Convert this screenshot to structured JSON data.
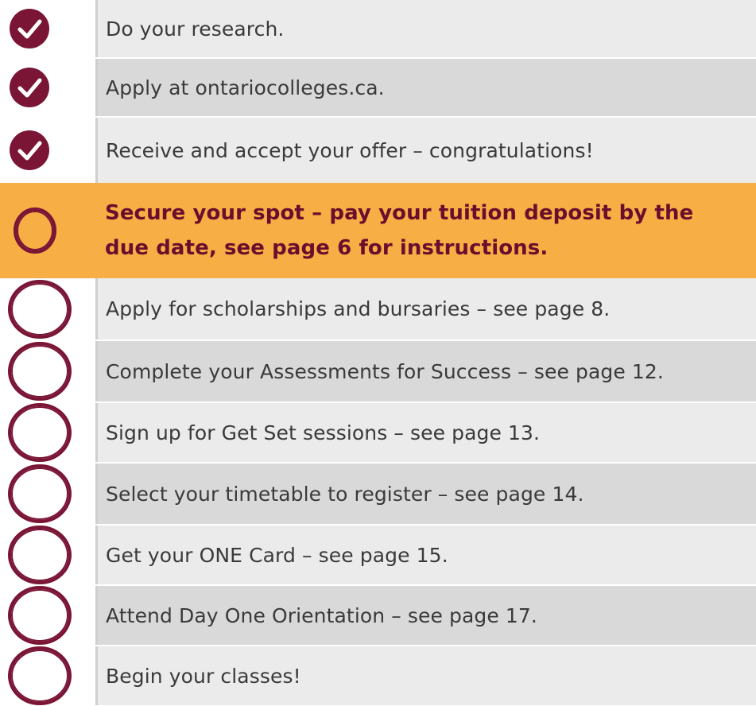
{
  "checklist": {
    "items": [
      {
        "text": "Do your research.",
        "status": "done"
      },
      {
        "text": "Apply at ontariocolleges.ca.",
        "status": "done"
      },
      {
        "text": "Receive and accept your offer – congratulations!",
        "status": "done"
      },
      {
        "text_line1": "Secure your spot – pay your tuition deposit by the",
        "text_line2": "due date, see page 6 for instructions.",
        "status": "current"
      },
      {
        "text": "Apply for scholarships and bursaries – see page 8.",
        "status": "todo"
      },
      {
        "text": "Complete your Assessments for Success – see page 12.",
        "status": "todo"
      },
      {
        "text": "Sign up for Get Set sessions – see page 13.",
        "status": "todo"
      },
      {
        "text": "Select your timetable to register – see page 14.",
        "status": "todo"
      },
      {
        "text": "Get your ONE Card – see page 15.",
        "status": "todo"
      },
      {
        "text": "Attend Day One Orientation – see page 17.",
        "status": "todo"
      },
      {
        "text": "Begin your classes!",
        "status": "todo"
      }
    ]
  },
  "icons": {
    "done": "checkmark-circle-icon",
    "current": "empty-circle-icon",
    "todo": "empty-circle-icon"
  },
  "colors": {
    "maroon": "#7a1535",
    "highlight": "#f6ae45",
    "row_light": "#ebebeb",
    "row_dark": "#d9d9d9",
    "text": "#3a3a3a"
  }
}
